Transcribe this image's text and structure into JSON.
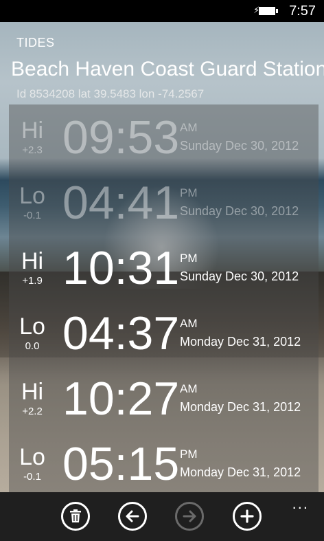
{
  "status": {
    "time": "7:57",
    "icons": [
      "charging-plug-icon",
      "battery-icon"
    ]
  },
  "header": {
    "app_title": "TIDES",
    "station_name": "Beach Haven Coast Guard Station",
    "meta": "Id 8534208 lat 39.5483 lon -74.2567"
  },
  "tides": [
    {
      "kind": "Hi",
      "height": "+2.3",
      "time": "09:53",
      "ampm": "AM",
      "date": "Sunday Dec 30, 2012",
      "past": true
    },
    {
      "kind": "Lo",
      "height": "-0.1",
      "time": "04:41",
      "ampm": "PM",
      "date": "Sunday Dec 30, 2012",
      "past": true
    },
    {
      "kind": "Hi",
      "height": "+1.9",
      "time": "10:31",
      "ampm": "PM",
      "date": "Sunday Dec 30, 2012",
      "past": false
    },
    {
      "kind": "Lo",
      "height": "0.0",
      "time": "04:37",
      "ampm": "AM",
      "date": "Monday Dec 31, 2012",
      "past": false
    },
    {
      "kind": "Hi",
      "height": "+2.2",
      "time": "10:27",
      "ampm": "AM",
      "date": "Monday Dec 31, 2012",
      "past": false
    },
    {
      "kind": "Lo",
      "height": "-0.1",
      "time": "05:15",
      "ampm": "PM",
      "date": "Monday Dec 31, 2012",
      "past": false
    }
  ],
  "app_bar": {
    "buttons": [
      {
        "name": "delete",
        "icon": "trash-icon",
        "enabled": true
      },
      {
        "name": "back",
        "icon": "arrow-left-icon",
        "enabled": true
      },
      {
        "name": "forward",
        "icon": "arrow-right-icon",
        "enabled": false
      },
      {
        "name": "add",
        "icon": "plus-icon",
        "enabled": true
      }
    ],
    "more_label": "..."
  }
}
